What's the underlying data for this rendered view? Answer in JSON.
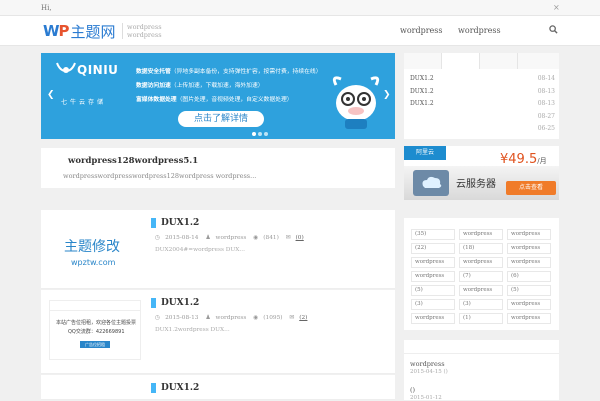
{
  "topbar": {
    "greeting": "Hi,",
    "close": "×"
  },
  "header": {
    "logo_wp_w": "W",
    "logo_wp_p": "P",
    "logo_cn": "主题网",
    "tagline": [
      "wordpress",
      "wordpress"
    ],
    "nav": [
      "wordpress",
      "wordpress"
    ]
  },
  "slider": {
    "brand": "QINIU",
    "brand_sub": "七牛云存储",
    "features": [
      {
        "head": "数据安全托管",
        "text": "（异地多副本备份，支持弹性扩容，按需付费，持续在线）"
      },
      {
        "head": "数据访问加速",
        "text": "（上传加速，下载加速，海外加速）"
      },
      {
        "head": "富媒体数据处理",
        "text": "（图片处理，音视频处理，自定义数据处理）"
      }
    ],
    "cta": "点击了解详情",
    "prev": "❮",
    "next": "❯"
  },
  "notice": {
    "title": "wordpress128wordpress5.1",
    "desc": "wordpresswordpresswordpress128wordpress wordpress..."
  },
  "posts": [
    {
      "title": "DUX1.2",
      "date": "2015-08-14",
      "author": "wordpress",
      "views": "(841)",
      "comments": "(0)",
      "excerpt": "DUX2004#=wordpress   DUX...",
      "thumb_text": "主题修改",
      "thumb_url": "wpztw.com"
    },
    {
      "title": "DUX1.2",
      "date": "2015-08-13",
      "author": "wordpress",
      "views": "(1095)",
      "comments": "(2)",
      "excerpt": "DUX1.2wordpress    DUX...",
      "thumb_lines": [
        "本站广告位招租，欢迎各位主题投票",
        "QQ交流群：422669891",
        "广告位招租"
      ]
    },
    {
      "title": "DUX1.2"
    }
  ],
  "sidebar_list": {
    "rows": [
      {
        "title": "DUX1.2",
        "date": "08-14"
      },
      {
        "title": "DUX1.2",
        "date": "08-13"
      },
      {
        "title": "DUX1.2",
        "date": "08-13"
      },
      {
        "title": "",
        "date": "08-27"
      },
      {
        "title": "",
        "date": "06-25"
      }
    ]
  },
  "ad": {
    "logo": "阿里云",
    "price": "¥49.5",
    "unit": "/月",
    "product": "云服务器",
    "button": "点击查看"
  },
  "tags": [
    "(35)",
    "wordpress",
    "wordpress",
    "(22)",
    "(18)",
    "wordpress",
    "wordpress",
    "wordpress",
    "wordpress",
    "wordpress",
    "(7)",
    "(6)",
    "(5)",
    "wordpress",
    "(5)",
    "(3)",
    "(3)",
    "wordpress",
    "wordpress",
    "(1)",
    "wordpress"
  ],
  "recent": {
    "item1": "wordpress",
    "item1_date": "2015-04-15",
    "item1_extra": "()",
    "item2": "()",
    "item2_date": "2015-01-12"
  },
  "colors": {
    "accent": "#2ea1dd",
    "brand": "#2a7bd1",
    "orange": "#f07b29"
  }
}
